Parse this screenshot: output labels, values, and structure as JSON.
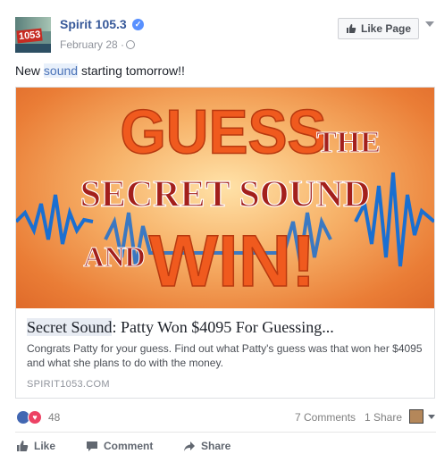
{
  "post": {
    "page_name": "Spirit 105.3",
    "avatar_text": "1053",
    "date": "February 28",
    "date_sep": "·",
    "like_page_label": "Like Page",
    "text_before": "New ",
    "text_highlight": "sound",
    "text_after": " starting tomorrow!!"
  },
  "link": {
    "image_lines": [
      "GUESS",
      "THE",
      "SECRET SOUND",
      "AND",
      "WIN!"
    ],
    "title_highlight": "Secret Sound",
    "title_rest": ": Patty Won $4095 For Guessing...",
    "description": "Congrats Patty for your guess. Find out what Patty's guess was that won her $4095 and what she plans to do with the money.",
    "domain": "SPIRIT1053.COM"
  },
  "stats": {
    "reactions": "48",
    "comments": "7 Comments",
    "shares": "1 Share"
  },
  "actions": {
    "like": "Like",
    "comment": "Comment",
    "share": "Share"
  },
  "colors": {
    "brand": "#365899",
    "like_button": "#4267b2",
    "love": "#ed4264",
    "image_text_orange": "#f05a1e",
    "image_text_red": "#a3201c",
    "wave_blue": "#1a6fd1"
  }
}
